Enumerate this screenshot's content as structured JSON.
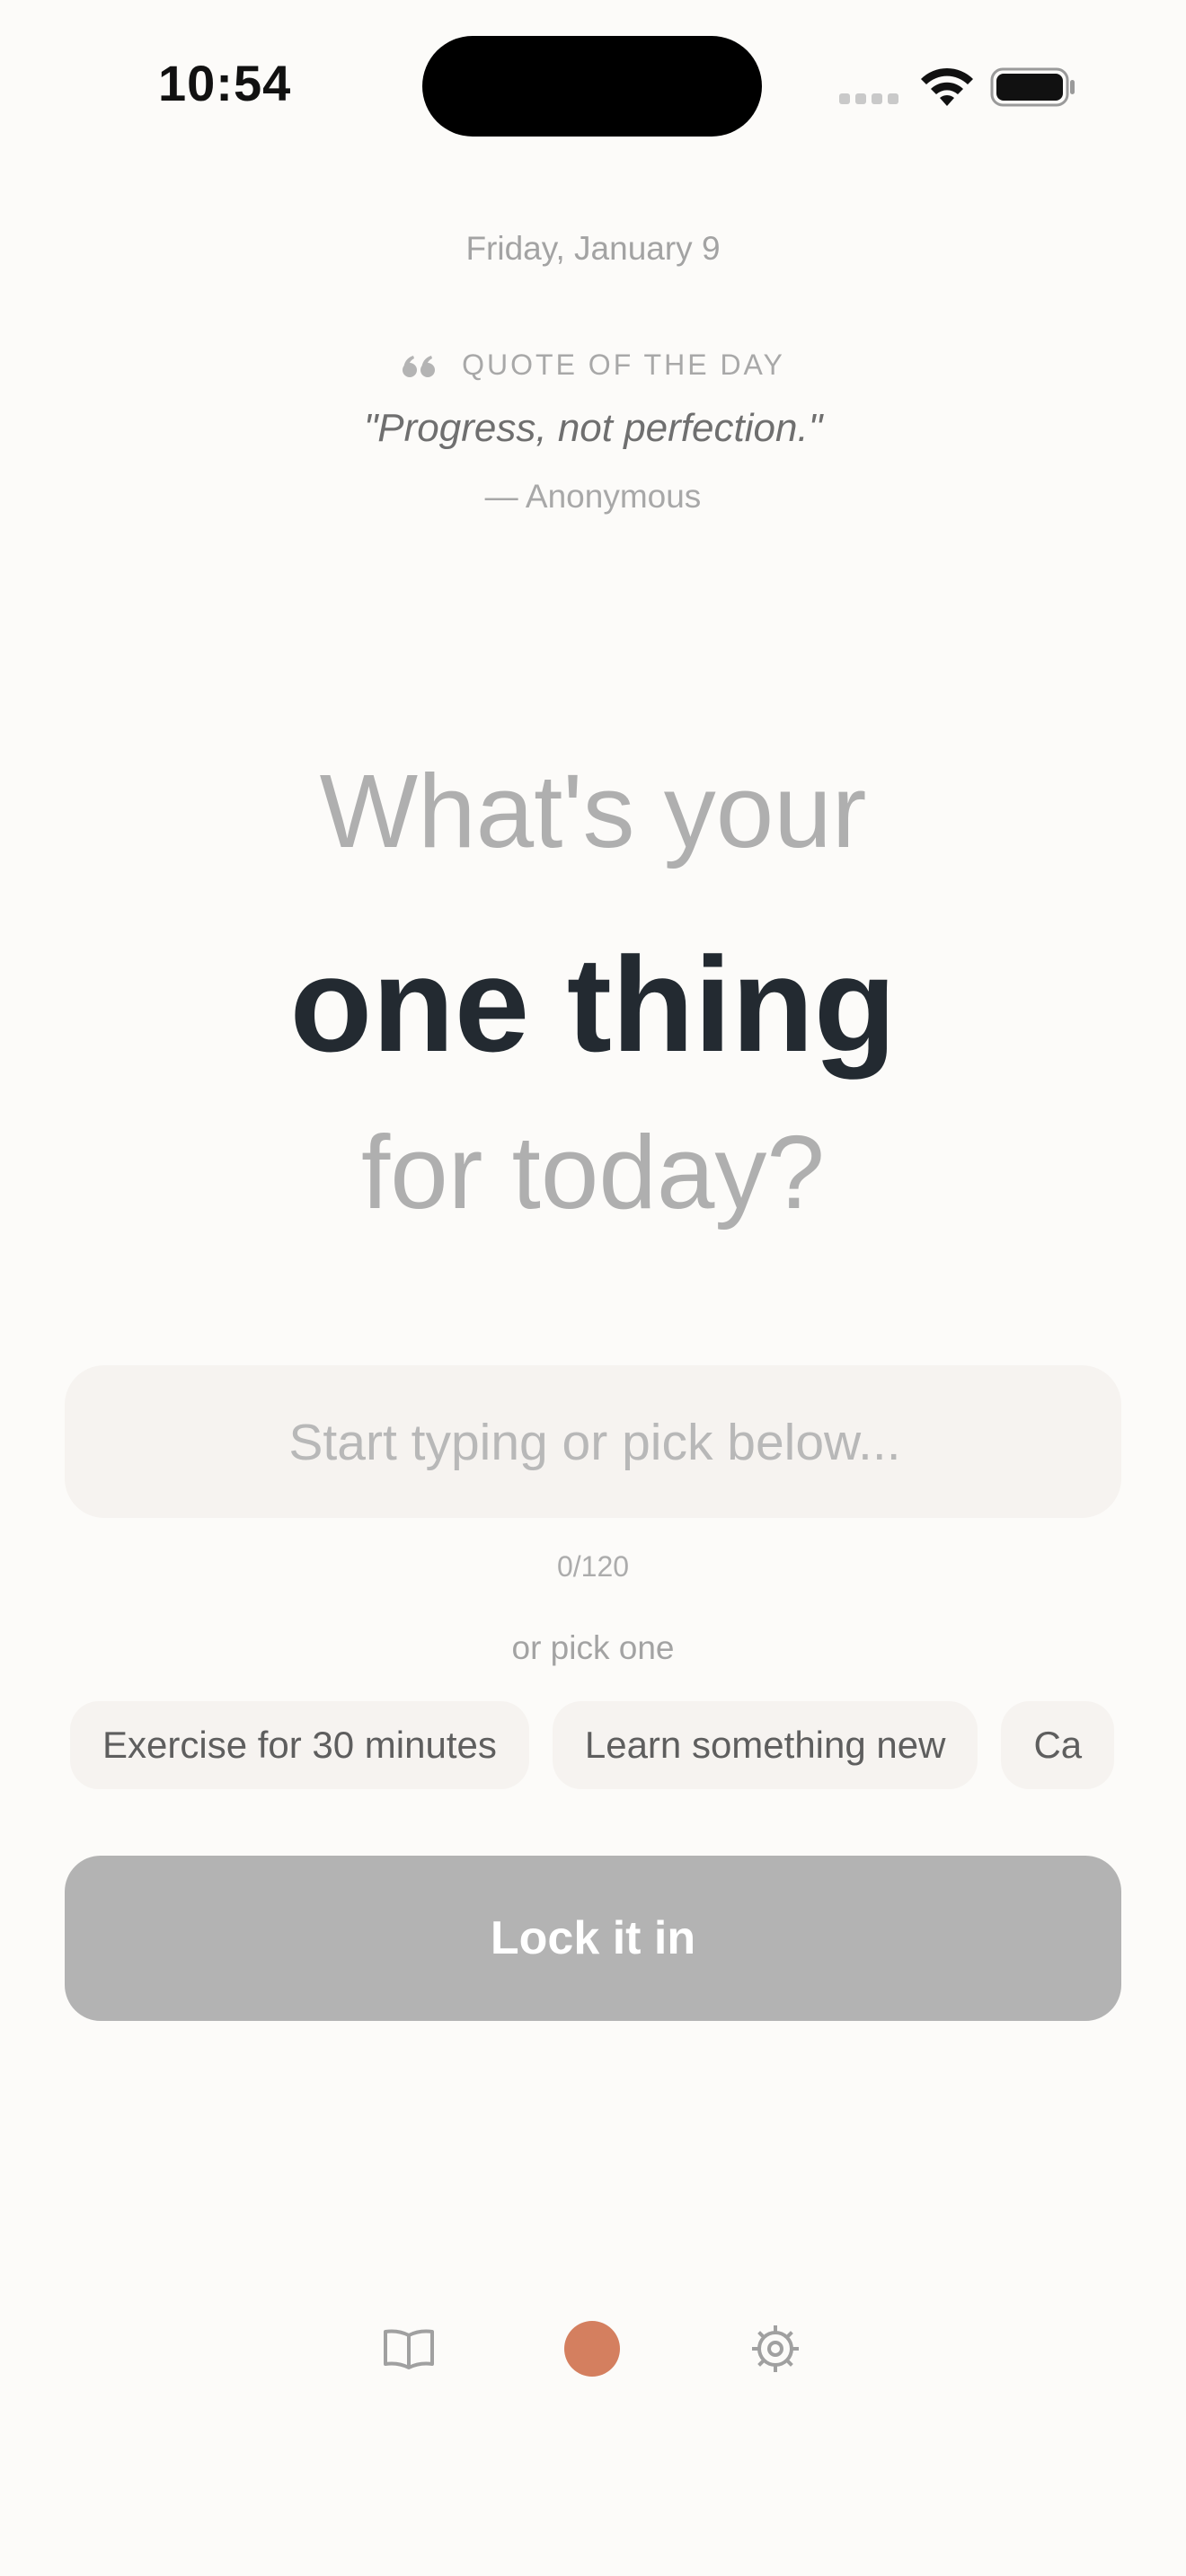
{
  "status_bar": {
    "time": "10:54"
  },
  "header": {
    "date": "Friday, January 9"
  },
  "quote": {
    "icon": "quote-icon",
    "label": "QUOTE OF THE DAY",
    "text": "\"Progress, not perfection.\"",
    "author": "— Anonymous"
  },
  "prompt": {
    "line1": "What's your",
    "line2": "one thing",
    "line3": "for today?"
  },
  "input": {
    "value": "",
    "placeholder": "Start typing or pick below...",
    "char_count": "0/120"
  },
  "suggestions": {
    "label": "or pick one",
    "items": [
      "Exercise for 30 minutes",
      "Learn something new",
      "Ca"
    ]
  },
  "action": {
    "lock_label": "Lock it in"
  },
  "tab_bar": {
    "items": [
      {
        "icon": "book-icon"
      },
      {
        "icon": "today-dot-icon"
      },
      {
        "icon": "gear-icon"
      }
    ]
  },
  "colors": {
    "background": "#fcfbf9",
    "accent": "#d47f5f",
    "heading_dark": "#232a31",
    "button_disabled": "#b3b3b3"
  }
}
